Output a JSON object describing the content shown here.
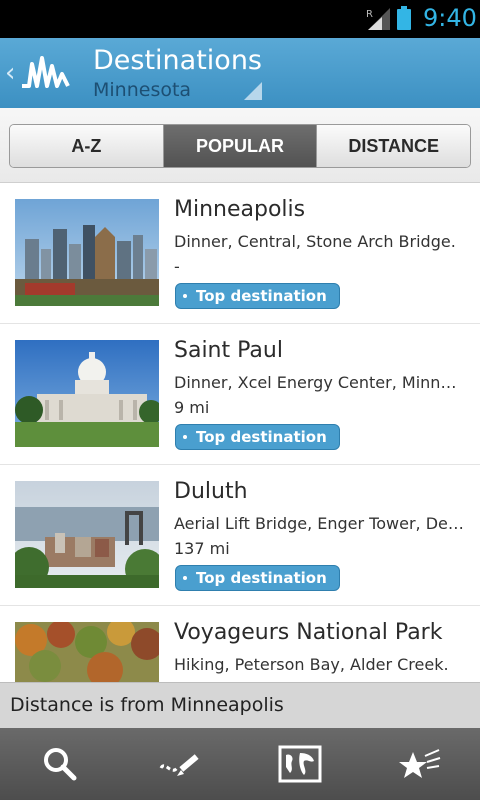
{
  "status_bar": {
    "time": "9:40",
    "roaming": "R"
  },
  "header": {
    "title": "Destinations",
    "subtitle": "Minnesota"
  },
  "tabs": [
    {
      "label": "A-Z",
      "active": false
    },
    {
      "label": "POPULAR",
      "active": true
    },
    {
      "label": "DISTANCE",
      "active": false
    }
  ],
  "destinations": [
    {
      "name": "Minneapolis",
      "description": "Dinner, Central, Stone Arch Bridge.",
      "distance": "-",
      "badge": "Top destination"
    },
    {
      "name": "Saint Paul",
      "description": "Dinner, Xcel Energy Center, Minnesota State Capitol",
      "distance": "9 mi",
      "badge": "Top destination"
    },
    {
      "name": "Duluth",
      "description": "Aerial Lift Bridge, Enger Tower, Depot",
      "distance": "137 mi",
      "badge": "Top destination"
    },
    {
      "name": "Voyageurs National Park",
      "description": "Hiking, Peterson Bay, Alder Creek.",
      "distance": "",
      "badge": ""
    }
  ],
  "footer_note": "Distance is from Minneapolis",
  "colors": {
    "accent": "#4a9fcf",
    "header": "#3c90c2",
    "status_time": "#33b5e5"
  },
  "bottom_nav": [
    {
      "icon": "search-icon"
    },
    {
      "icon": "trip-planner-icon"
    },
    {
      "icon": "world-map-icon"
    },
    {
      "icon": "favorites-stars-icon"
    }
  ]
}
